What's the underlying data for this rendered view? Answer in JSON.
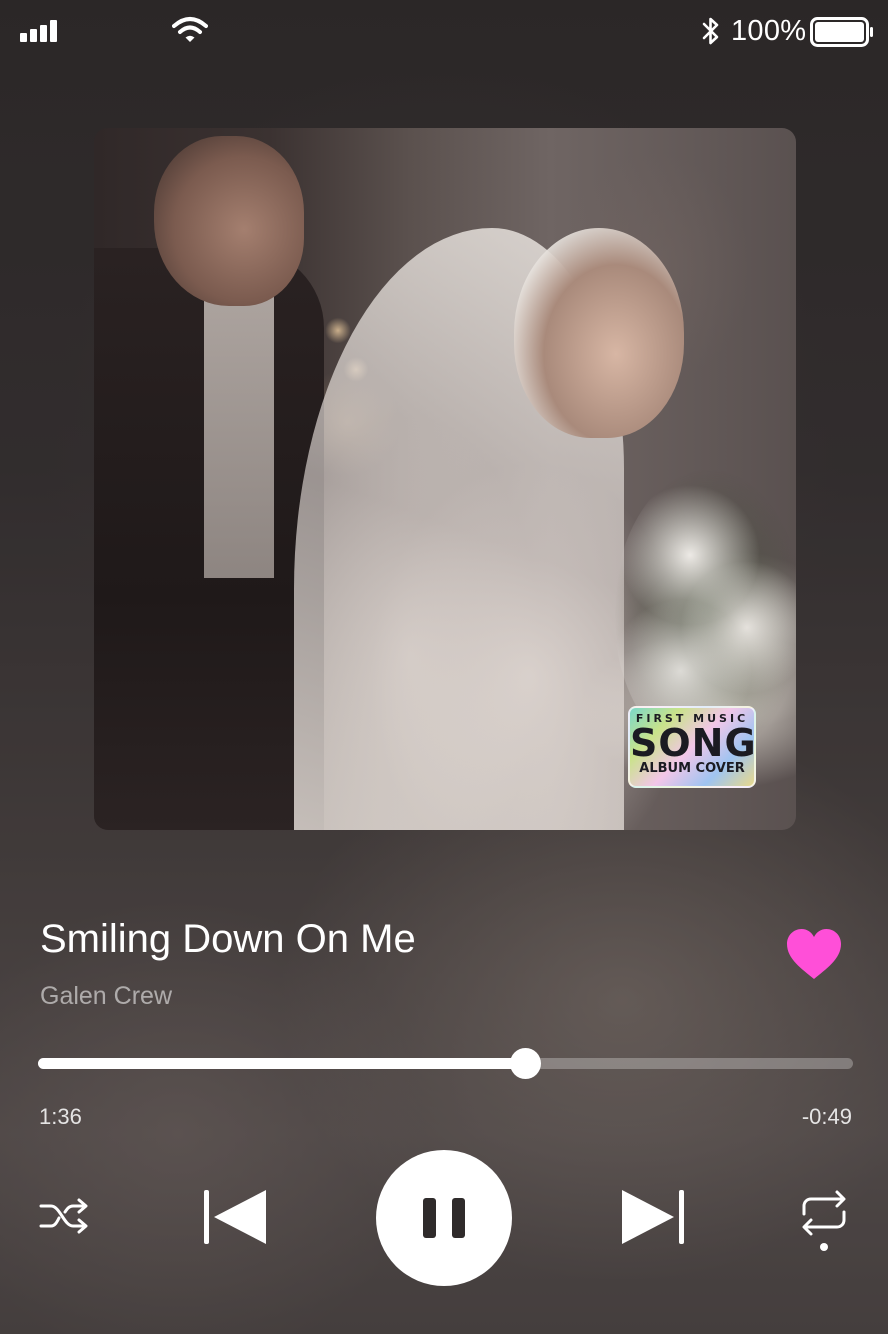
{
  "status_bar": {
    "battery_text": "100%",
    "battery_level": 1.0,
    "icons": [
      "signal-icon",
      "wifi-icon",
      "bluetooth-icon",
      "battery-icon"
    ]
  },
  "album": {
    "badge_top": "FIRST MUSIC",
    "badge_main": "SONG",
    "badge_bottom": "ALBUM COVER"
  },
  "song": {
    "title": "Smiling Down On Me",
    "artist": "Galen Crew",
    "liked": true,
    "heart_color": "#ff4fd8"
  },
  "playback": {
    "elapsed": "1:36",
    "remaining": "-0:49",
    "progress": 0.597,
    "state": "playing"
  },
  "controls": {
    "icons": [
      "shuffle-icon",
      "previous-icon",
      "pause-icon",
      "next-icon",
      "repeat-icon"
    ]
  }
}
